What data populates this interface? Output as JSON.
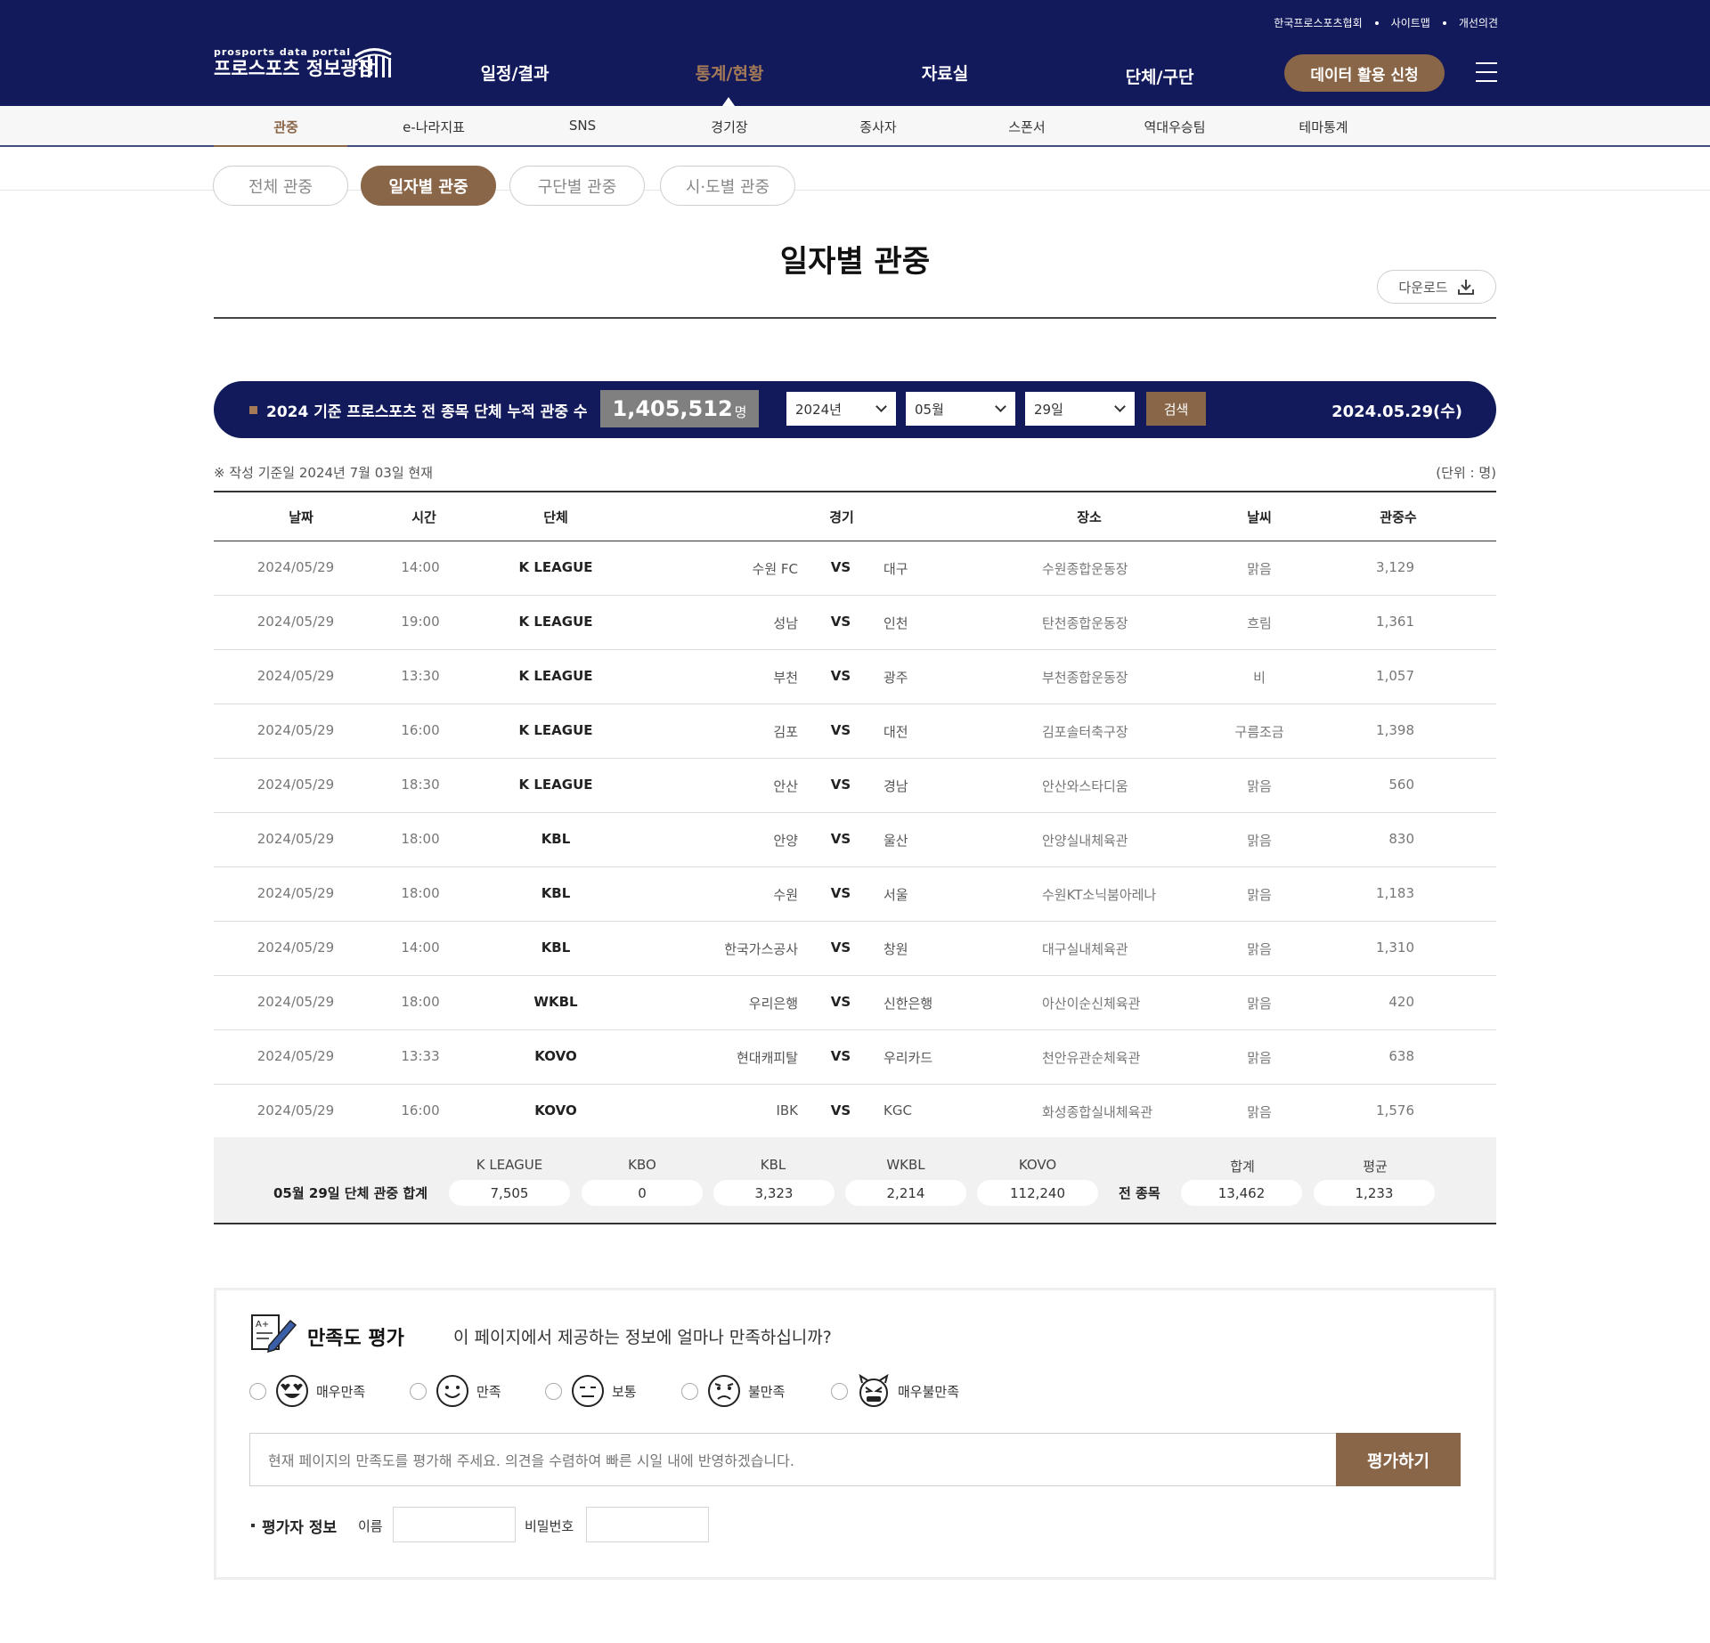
{
  "util_links": [
    "한국프로스포츠협회",
    "사이트맵",
    "개선의견"
  ],
  "logo": {
    "en": "prosports data portal",
    "ko": "프로스포츠 정보광장"
  },
  "gnb": [
    "일정/결과",
    "통계/현황",
    "자료실",
    "단체/구단"
  ],
  "gnb_active": "통계/현황",
  "apply_button": "데이터 활용 신청",
  "subnav": [
    "관중",
    "e-나라지표",
    "SNS",
    "경기장",
    "종사자",
    "스폰서",
    "역대우승팀",
    "테마통계"
  ],
  "subnav_active": "관중",
  "tabs": [
    "전체 관중",
    "일자별 관중",
    "구단별 관중",
    "시·도별 관중"
  ],
  "tab_active": "일자별 관중",
  "page_title": "일자별 관중",
  "download_label": "다운로드",
  "summary": {
    "label": "2024 기준 프로스포츠 전 종목 단체 누적 관중 수",
    "count": "1,405,512",
    "count_unit": "명",
    "year": "2024년",
    "month": "05월",
    "day": "29일",
    "search_label": "검색",
    "date": "2024.05.29(수)"
  },
  "note": "※ 작성 기준일 2024년 7월 03일 현재",
  "unit": "(단위 : 명)",
  "table": {
    "headers": [
      "날짜",
      "시간",
      "단체",
      "경기",
      "장소",
      "날씨",
      "관중수"
    ],
    "vs_label": "VS",
    "rows": [
      {
        "date": "2024/05/29",
        "time": "14:00",
        "assoc": "K LEAGUE",
        "home": "수원 FC",
        "away": "대구",
        "venue": "수원종합운동장",
        "weather": "맑음",
        "attendance": "3,129"
      },
      {
        "date": "2024/05/29",
        "time": "19:00",
        "assoc": "K LEAGUE",
        "home": "성남",
        "away": "인천",
        "venue": "탄천종합운동장",
        "weather": "흐림",
        "attendance": "1,361"
      },
      {
        "date": "2024/05/29",
        "time": "13:30",
        "assoc": "K LEAGUE",
        "home": "부천",
        "away": "광주",
        "venue": "부천종합운동장",
        "weather": "비",
        "attendance": "1,057"
      },
      {
        "date": "2024/05/29",
        "time": "16:00",
        "assoc": "K LEAGUE",
        "home": "김포",
        "away": "대전",
        "venue": "김포솔터축구장",
        "weather": "구름조금",
        "attendance": "1,398"
      },
      {
        "date": "2024/05/29",
        "time": "18:30",
        "assoc": "K LEAGUE",
        "home": "안산",
        "away": "경남",
        "venue": "안산와스타디움",
        "weather": "맑음",
        "attendance": "560"
      },
      {
        "date": "2024/05/29",
        "time": "18:00",
        "assoc": "KBL",
        "home": "안양",
        "away": "울산",
        "venue": "안양실내체육관",
        "weather": "맑음",
        "attendance": "830"
      },
      {
        "date": "2024/05/29",
        "time": "18:00",
        "assoc": "KBL",
        "home": "수원",
        "away": "서울",
        "venue": "수원KT소닉붐아레나",
        "weather": "맑음",
        "attendance": "1,183"
      },
      {
        "date": "2024/05/29",
        "time": "14:00",
        "assoc": "KBL",
        "home": "한국가스공사",
        "away": "창원",
        "venue": "대구실내체육관",
        "weather": "맑음",
        "attendance": "1,310"
      },
      {
        "date": "2024/05/29",
        "time": "18:00",
        "assoc": "WKBL",
        "home": "우리은행",
        "away": "신한은행",
        "venue": "아산이순신체육관",
        "weather": "맑음",
        "attendance": "420"
      },
      {
        "date": "2024/05/29",
        "time": "13:33",
        "assoc": "KOVO",
        "home": "현대캐피탈",
        "away": "우리카드",
        "venue": "천안유관순체육관",
        "weather": "맑음",
        "attendance": "638"
      },
      {
        "date": "2024/05/29",
        "time": "16:00",
        "assoc": "KOVO",
        "home": "IBK",
        "away": "KGC",
        "venue": "화성종합실내체육관",
        "weather": "맑음",
        "attendance": "1,576"
      }
    ]
  },
  "totals": {
    "label": "05월 29일 단체 관중 합계",
    "all_label": "전 종목",
    "items": [
      {
        "name": "K LEAGUE",
        "value": "7,505"
      },
      {
        "name": "KBO",
        "value": "0"
      },
      {
        "name": "KBL",
        "value": "3,323"
      },
      {
        "name": "WKBL",
        "value": "2,214"
      },
      {
        "name": "KOVO",
        "value": "112,240"
      }
    ],
    "sum": {
      "name": "합계",
      "value": "13,462"
    },
    "avg": {
      "name": "평균",
      "value": "1,233"
    }
  },
  "survey": {
    "title": "만족도 평가",
    "question": "이 페이지에서 제공하는 정보에 얼마나 만족하십니까?",
    "options": [
      "매우만족",
      "만족",
      "보통",
      "불만족",
      "매우불만족"
    ],
    "placeholder": "현재 페이지의 만족도를 평가해 주세요. 의견을 수렴하여 빠른 시일 내에 반영하겠습니다.",
    "submit_label": "평가하기",
    "info_label": "평가자 정보",
    "name_label": "이름",
    "password_label": "비밀번호"
  },
  "colors": {
    "navy": "#121a5c",
    "brown": "#8a6649",
    "gold": "#a57a56"
  }
}
